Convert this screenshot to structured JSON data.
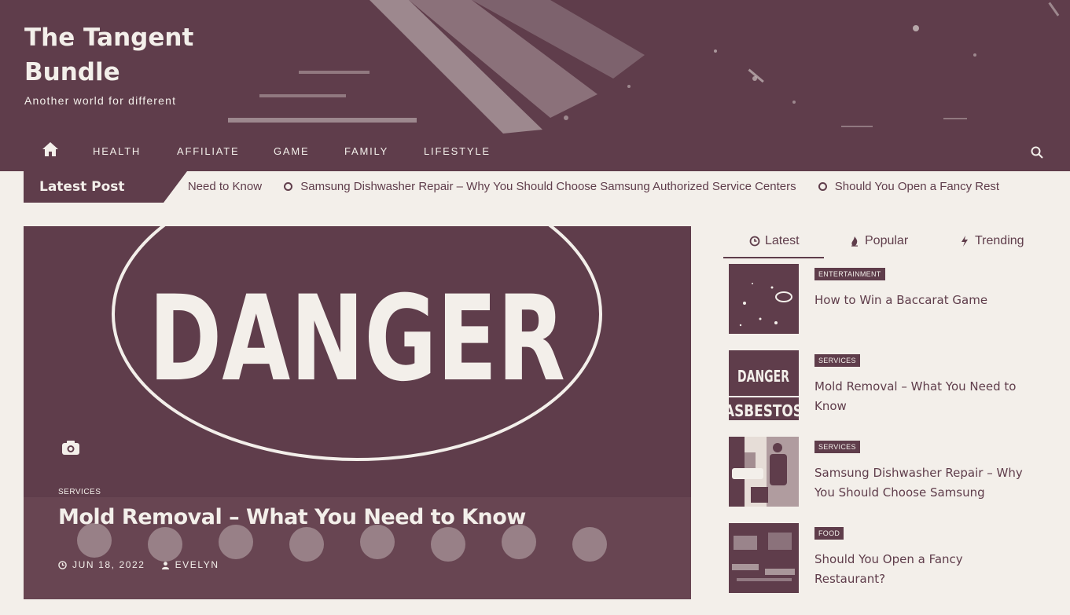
{
  "site": {
    "title": "The Tangent Bundle",
    "tagline": "Another world for different"
  },
  "nav": {
    "home_icon": "home-icon",
    "items": [
      "HEALTH",
      "AFFILIATE",
      "GAME",
      "FAMILY",
      "LIFESTYLE"
    ],
    "search_icon": "search-icon"
  },
  "ticker": {
    "label": "Latest Post",
    "items": [
      "ou Need to Know",
      "Samsung Dishwasher Repair – Why You Should Choose Samsung Authorized Service Centers",
      "Should You Open a Fancy Rest"
    ]
  },
  "feature": {
    "image_text": "DANGER",
    "category": "SERVICES",
    "title": "Mold Removal – What You Need to Know",
    "date": "JUN 18, 2022",
    "author": "EVELYN"
  },
  "sidebar": {
    "tabs": [
      {
        "label": "Latest",
        "icon": "clock-icon"
      },
      {
        "label": "Popular",
        "icon": "fire-icon"
      },
      {
        "label": "Trending",
        "icon": "bolt-icon"
      }
    ],
    "posts": [
      {
        "category": "ENTERTAINMENT",
        "title": "How to Win a Baccarat Game"
      },
      {
        "category": "SERVICES",
        "title": "Mold Removal – What You Need to Know",
        "thumb_text_1": "DANGER",
        "thumb_text_2": "ASBESTOS"
      },
      {
        "category": "SERVICES",
        "title": "Samsung Dishwasher Repair – Why You Should Choose Samsung"
      },
      {
        "category": "FOOD",
        "title": "Should You Open a Fancy Restaurant?"
      }
    ]
  },
  "colors": {
    "primary": "#5f3d4b",
    "background": "#f3efea"
  }
}
